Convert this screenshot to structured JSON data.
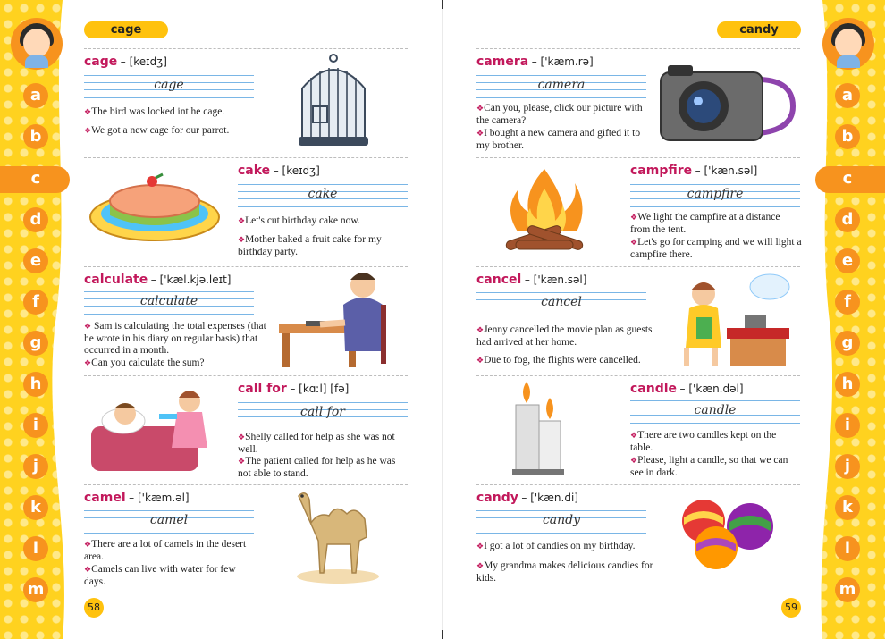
{
  "left_page": {
    "guide_word": "cage",
    "page_number": "58",
    "entries": [
      {
        "word": "cage",
        "pronunciation": "[keɪdʒ]",
        "script": "cage",
        "sentences": [
          "The bird was locked int he cage.",
          "We got a new cage for our parrot."
        ],
        "picture": "birdcage"
      },
      {
        "word": "cake",
        "pronunciation": "[keɪdʒ]",
        "script": "cake",
        "sentences": [
          "Let's cut birthday cake now.",
          "Mother baked a fruit cake for my birthday party."
        ],
        "picture": "cake"
      },
      {
        "word": "calculate",
        "pronunciation": "['kæl.kjə.leɪt]",
        "script": "calculate",
        "sentences": [
          "Sam is calculating the total expenses (that he wrote in his diary on regular basis) that occurred in a month.",
          "Can you calculate the sum?"
        ],
        "picture": "man-calculating"
      },
      {
        "word": "call for",
        "pronunciation": "[kɑːl] [fə]",
        "script": "call for",
        "sentences": [
          "Shelly called for help as she was not well.",
          "The patient called for help as he was not able to stand."
        ],
        "picture": "sick-girl"
      },
      {
        "word": "camel",
        "pronunciation": "['kæm.əl]",
        "script": "camel",
        "sentences": [
          "There are a lot of camels in the desert area.",
          "Camels can live with water for few days."
        ],
        "picture": "camel"
      }
    ]
  },
  "right_page": {
    "guide_word": "candy",
    "page_number": "59",
    "entries": [
      {
        "word": "camera",
        "pronunciation": "['kæm.rə]",
        "script": "camera",
        "sentences": [
          "Can you, please, click our picture with the camera?",
          "I bought a new camera and gifted it to my brother."
        ],
        "picture": "camera"
      },
      {
        "word": "campfire",
        "pronunciation": "['kæn.səl]",
        "script": "campfire",
        "sentences": [
          "We light the campfire at a distance from the tent.",
          "Let's go for camping and we will light a campfire there."
        ],
        "picture": "campfire"
      },
      {
        "word": "cancel",
        "pronunciation": "['kæn.səl]",
        "script": "cancel",
        "sentences": [
          "Jenny cancelled the movie plan as guests had arrived at her home.",
          "Due to fog, the flights were cancelled."
        ],
        "picture": "girl-phone"
      },
      {
        "word": "candle",
        "pronunciation": "['kæn.dəl]",
        "script": "candle",
        "sentences": [
          "There are two candles kept on the table.",
          "Please, light a candle, so that we can see in dark."
        ],
        "picture": "candles"
      },
      {
        "word": "candy",
        "pronunciation": "['kæn.di]",
        "script": "candy",
        "sentences": [
          "I got a lot of candies on my birthday.",
          "My grandma makes delicious candies for kids."
        ],
        "picture": "candies"
      }
    ]
  },
  "alphabet": [
    "a",
    "b",
    "c",
    "d",
    "e",
    "f",
    "g",
    "h",
    "i",
    "j",
    "k",
    "l",
    "m"
  ],
  "active_letter": "c",
  "colors": {
    "accent": "#f7931e",
    "tab": "#ffc20e",
    "headword": "#c2185b",
    "rule": "#7ab6e6"
  }
}
